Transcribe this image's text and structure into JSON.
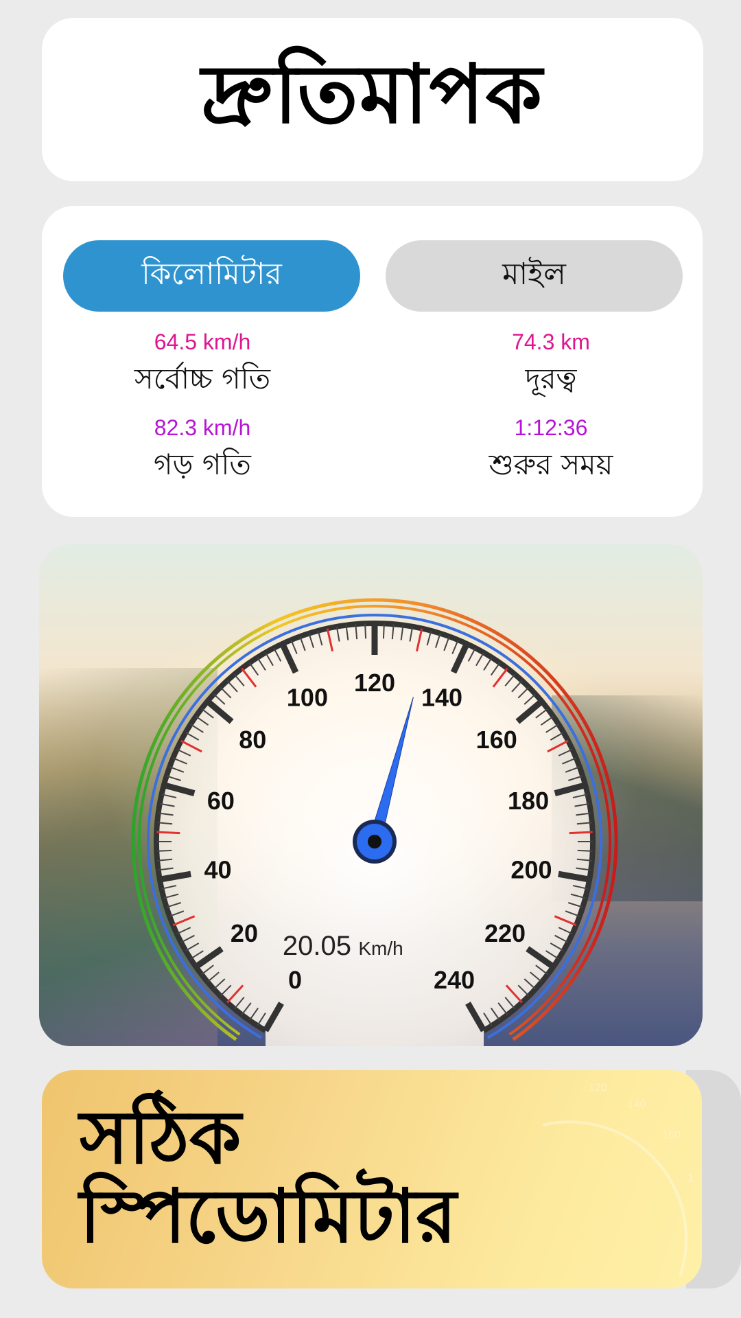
{
  "header": {
    "title": "দ্রুতিমাপক"
  },
  "units": {
    "kilometer_label": "কিলোমিটার",
    "mile_label": "মাইল",
    "selected": "kilometer"
  },
  "stats": {
    "max_speed": {
      "value": "64.5 km/h",
      "label": "সর্বোচ্চ গতি"
    },
    "distance": {
      "value": "74.3 km",
      "label": "দূরত্ব"
    },
    "avg_speed": {
      "value": "82.3 km/h",
      "label": "গড় গতি"
    },
    "start_time": {
      "value": "1:12:36",
      "label": "শুরুর সময়"
    }
  },
  "gauge": {
    "min": 0,
    "max": 240,
    "major_ticks": [
      "0",
      "20",
      "40",
      "60",
      "80",
      "100",
      "120",
      "140",
      "160",
      "180",
      "200",
      "220",
      "240"
    ],
    "needle_value": 132,
    "readout_value": "20.05",
    "readout_unit": "Km/h",
    "colors": {
      "needle": "#2b6cf0",
      "outer_green": "#2aa52a",
      "outer_yellow": "#f3c624",
      "outer_orange": "#f08a2c",
      "outer_red": "#c81b1b",
      "inner_blue": "#3b6fe0",
      "minor_red": "#e03030"
    }
  },
  "banner": {
    "line1": "সঠিক",
    "line2": "স্পিডোমিটার",
    "deco_ticks": [
      "120",
      "140",
      "160",
      "180",
      "200",
      "220"
    ]
  },
  "colors": {
    "accent": "#2f93d0",
    "stat_pink": "#e0158f",
    "stat_purple": "#b613d6"
  }
}
